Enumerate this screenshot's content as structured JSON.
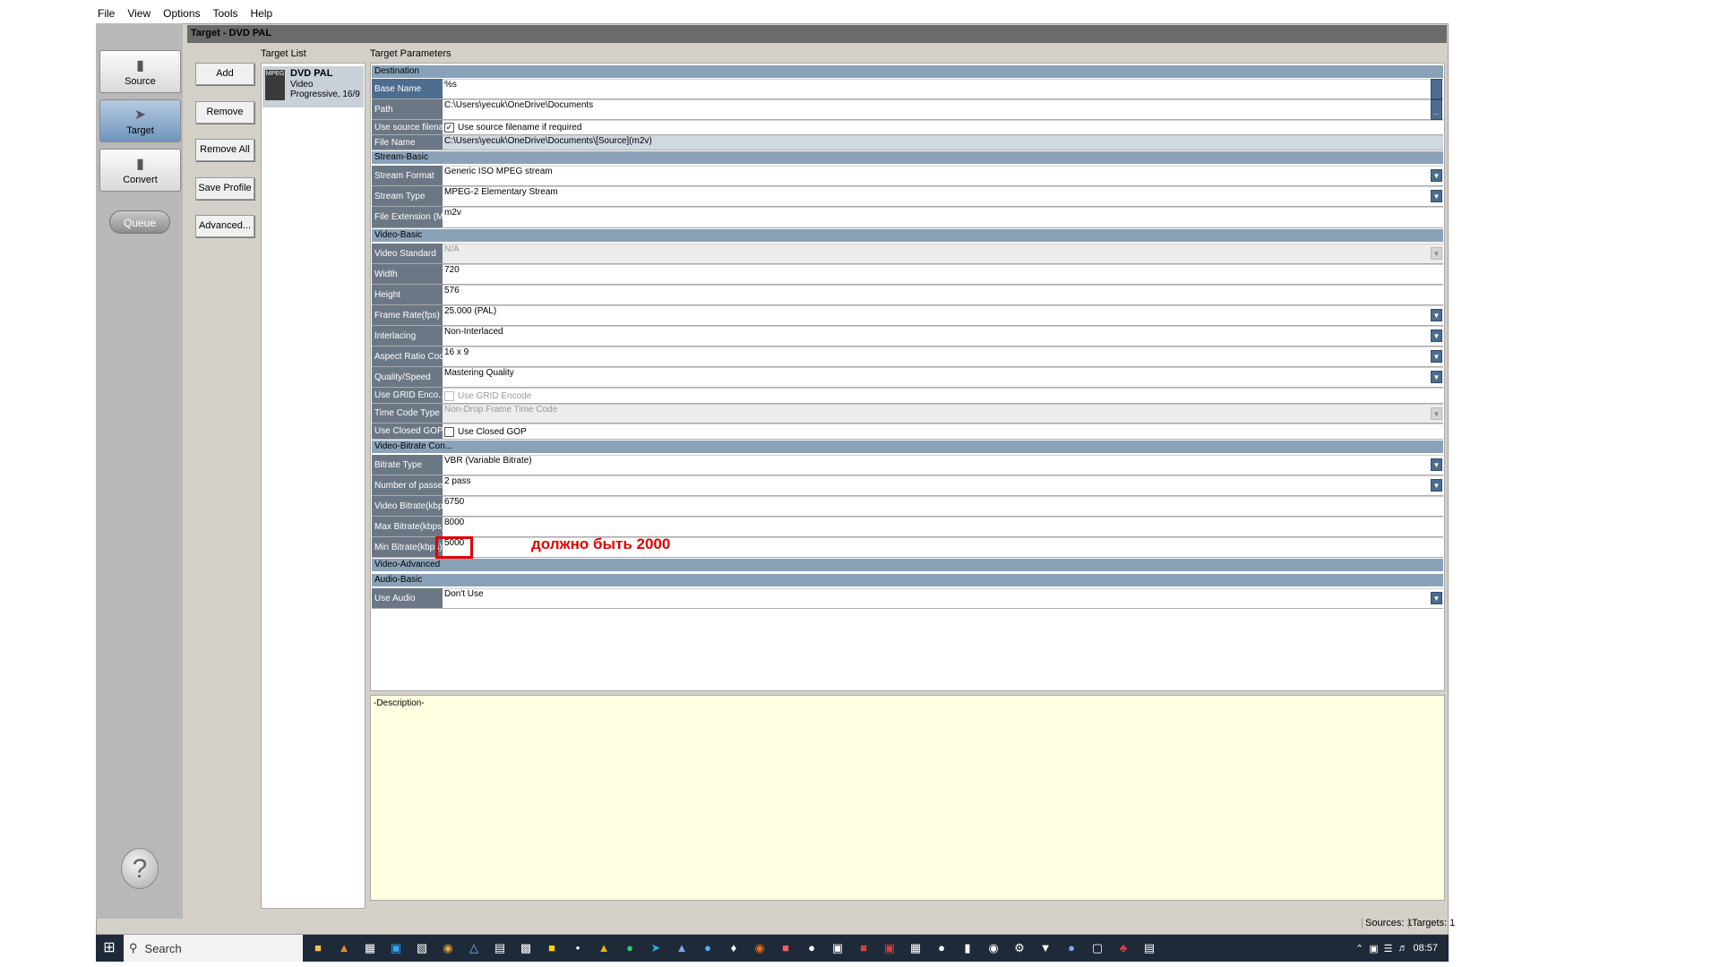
{
  "menu": [
    "File",
    "View",
    "Options",
    "Tools",
    "Help"
  ],
  "nav": {
    "source": "Source",
    "target": "Target",
    "convert": "Convert",
    "queue": "Queue",
    "help_symbol": "?"
  },
  "title": "Target - DVD PAL",
  "buttons": {
    "add": "Add",
    "remove": "Remove",
    "remove_all": "Remove All",
    "save_profile": "Save Profile",
    "advanced": "Advanced..."
  },
  "target_list": {
    "label": "Target List",
    "item": {
      "icon_text": "MPEG",
      "name": "DVD PAL",
      "desc": "Video Progressive, 16/9"
    }
  },
  "params": {
    "label": "Target Parameters",
    "destination": {
      "header": "Destination",
      "base_name_label": "Base Name",
      "base_name": "%s",
      "path_label": "Path",
      "path": "C:\\Users\\yecuk\\OneDrive\\Documents",
      "use_src_label": "Use source filena...",
      "use_src_text": "Use source filename if required",
      "file_name_label": "File Name",
      "file_name": "C:\\Users\\yecuk\\OneDrive\\Documents\\[Source](m2v)"
    },
    "stream_basic": {
      "header": "Stream-Basic",
      "format_label": "Stream Format",
      "format": "Generic ISO MPEG stream",
      "type_label": "Stream Type",
      "type": "MPEG-2 Elementary Stream",
      "ext_label": "File Extension (M...",
      "ext": "m2v"
    },
    "video_basic": {
      "header": "Video-Basic",
      "standard_label": "Video Standard",
      "standard": "N/A",
      "width_label": "Width",
      "width": "720",
      "height_label": "Height",
      "height": "576",
      "frame_rate_label": "Frame Rate(fps)",
      "frame_rate": "25.000 (PAL)",
      "interlacing_label": "Interlacing",
      "interlacing": "Non-Interlaced",
      "aspect_label": "Aspect Ratio Code",
      "aspect": "16 x 9",
      "quality_label": "Quality/Speed",
      "quality": "Mastering Quality",
      "grid_label": "Use GRID Enco...",
      "grid_text": "Use GRID Encode",
      "timecode_label": "Time Code Type",
      "timecode": "Non-Drop Frame Time Code",
      "closed_gop_label": "Use Closed GOP",
      "closed_gop_text": "Use Closed GOP"
    },
    "bitrate": {
      "header": "Video-Bitrate Con...",
      "type_label": "Bitrate Type",
      "type": "VBR (Variable Bitrate)",
      "passes_label": "Number of passes",
      "passes": "2 pass",
      "video_label": "Video Bitrate(kbps)",
      "video": "6750",
      "max_label": "Max Bitrate(kbps)",
      "max": "8000",
      "min_label": "Min Bitrate(kbps)",
      "min": "5000"
    },
    "video_advanced": {
      "header": "Video-Advanced"
    },
    "audio_basic": {
      "header": "Audio-Basic",
      "use_audio_label": "Use Audio",
      "use_audio": "Don't Use"
    }
  },
  "annotation": "должно быть 2000",
  "description": "-Description-",
  "status": {
    "sources": "Sources: 1",
    "targets": "Targets: 1"
  },
  "taskbar": {
    "search": "Search",
    "time": "08:57"
  },
  "colors": {
    "annotation": "#e00000",
    "section": "#8aa2b8",
    "label_bg": "#6b7785",
    "desc_bg": "#ffffe1"
  }
}
